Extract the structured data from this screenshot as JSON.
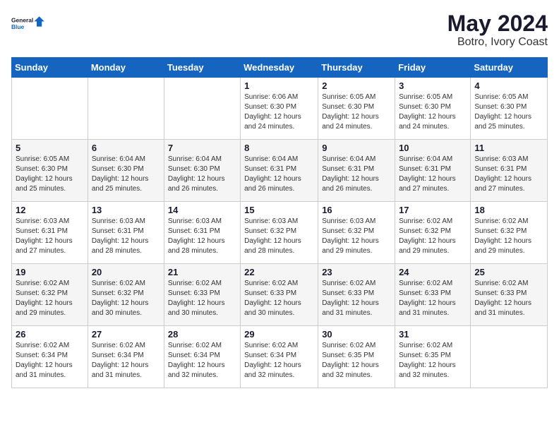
{
  "header": {
    "logo_line1": "General",
    "logo_line2": "Blue",
    "title": "May 2024",
    "subtitle": "Botro, Ivory Coast"
  },
  "days_of_week": [
    "Sunday",
    "Monday",
    "Tuesday",
    "Wednesday",
    "Thursday",
    "Friday",
    "Saturday"
  ],
  "weeks": [
    [
      {
        "day": "",
        "sunrise": "",
        "sunset": "",
        "daylight": ""
      },
      {
        "day": "",
        "sunrise": "",
        "sunset": "",
        "daylight": ""
      },
      {
        "day": "",
        "sunrise": "",
        "sunset": "",
        "daylight": ""
      },
      {
        "day": "1",
        "sunrise": "Sunrise: 6:06 AM",
        "sunset": "Sunset: 6:30 PM",
        "daylight": "Daylight: 12 hours and 24 minutes."
      },
      {
        "day": "2",
        "sunrise": "Sunrise: 6:05 AM",
        "sunset": "Sunset: 6:30 PM",
        "daylight": "Daylight: 12 hours and 24 minutes."
      },
      {
        "day": "3",
        "sunrise": "Sunrise: 6:05 AM",
        "sunset": "Sunset: 6:30 PM",
        "daylight": "Daylight: 12 hours and 24 minutes."
      },
      {
        "day": "4",
        "sunrise": "Sunrise: 6:05 AM",
        "sunset": "Sunset: 6:30 PM",
        "daylight": "Daylight: 12 hours and 25 minutes."
      }
    ],
    [
      {
        "day": "5",
        "sunrise": "Sunrise: 6:05 AM",
        "sunset": "Sunset: 6:30 PM",
        "daylight": "Daylight: 12 hours and 25 minutes."
      },
      {
        "day": "6",
        "sunrise": "Sunrise: 6:04 AM",
        "sunset": "Sunset: 6:30 PM",
        "daylight": "Daylight: 12 hours and 25 minutes."
      },
      {
        "day": "7",
        "sunrise": "Sunrise: 6:04 AM",
        "sunset": "Sunset: 6:30 PM",
        "daylight": "Daylight: 12 hours and 26 minutes."
      },
      {
        "day": "8",
        "sunrise": "Sunrise: 6:04 AM",
        "sunset": "Sunset: 6:31 PM",
        "daylight": "Daylight: 12 hours and 26 minutes."
      },
      {
        "day": "9",
        "sunrise": "Sunrise: 6:04 AM",
        "sunset": "Sunset: 6:31 PM",
        "daylight": "Daylight: 12 hours and 26 minutes."
      },
      {
        "day": "10",
        "sunrise": "Sunrise: 6:04 AM",
        "sunset": "Sunset: 6:31 PM",
        "daylight": "Daylight: 12 hours and 27 minutes."
      },
      {
        "day": "11",
        "sunrise": "Sunrise: 6:03 AM",
        "sunset": "Sunset: 6:31 PM",
        "daylight": "Daylight: 12 hours and 27 minutes."
      }
    ],
    [
      {
        "day": "12",
        "sunrise": "Sunrise: 6:03 AM",
        "sunset": "Sunset: 6:31 PM",
        "daylight": "Daylight: 12 hours and 27 minutes."
      },
      {
        "day": "13",
        "sunrise": "Sunrise: 6:03 AM",
        "sunset": "Sunset: 6:31 PM",
        "daylight": "Daylight: 12 hours and 28 minutes."
      },
      {
        "day": "14",
        "sunrise": "Sunrise: 6:03 AM",
        "sunset": "Sunset: 6:31 PM",
        "daylight": "Daylight: 12 hours and 28 minutes."
      },
      {
        "day": "15",
        "sunrise": "Sunrise: 6:03 AM",
        "sunset": "Sunset: 6:32 PM",
        "daylight": "Daylight: 12 hours and 28 minutes."
      },
      {
        "day": "16",
        "sunrise": "Sunrise: 6:03 AM",
        "sunset": "Sunset: 6:32 PM",
        "daylight": "Daylight: 12 hours and 29 minutes."
      },
      {
        "day": "17",
        "sunrise": "Sunrise: 6:02 AM",
        "sunset": "Sunset: 6:32 PM",
        "daylight": "Daylight: 12 hours and 29 minutes."
      },
      {
        "day": "18",
        "sunrise": "Sunrise: 6:02 AM",
        "sunset": "Sunset: 6:32 PM",
        "daylight": "Daylight: 12 hours and 29 minutes."
      }
    ],
    [
      {
        "day": "19",
        "sunrise": "Sunrise: 6:02 AM",
        "sunset": "Sunset: 6:32 PM",
        "daylight": "Daylight: 12 hours and 29 minutes."
      },
      {
        "day": "20",
        "sunrise": "Sunrise: 6:02 AM",
        "sunset": "Sunset: 6:32 PM",
        "daylight": "Daylight: 12 hours and 30 minutes."
      },
      {
        "day": "21",
        "sunrise": "Sunrise: 6:02 AM",
        "sunset": "Sunset: 6:33 PM",
        "daylight": "Daylight: 12 hours and 30 minutes."
      },
      {
        "day": "22",
        "sunrise": "Sunrise: 6:02 AM",
        "sunset": "Sunset: 6:33 PM",
        "daylight": "Daylight: 12 hours and 30 minutes."
      },
      {
        "day": "23",
        "sunrise": "Sunrise: 6:02 AM",
        "sunset": "Sunset: 6:33 PM",
        "daylight": "Daylight: 12 hours and 31 minutes."
      },
      {
        "day": "24",
        "sunrise": "Sunrise: 6:02 AM",
        "sunset": "Sunset: 6:33 PM",
        "daylight": "Daylight: 12 hours and 31 minutes."
      },
      {
        "day": "25",
        "sunrise": "Sunrise: 6:02 AM",
        "sunset": "Sunset: 6:33 PM",
        "daylight": "Daylight: 12 hours and 31 minutes."
      }
    ],
    [
      {
        "day": "26",
        "sunrise": "Sunrise: 6:02 AM",
        "sunset": "Sunset: 6:34 PM",
        "daylight": "Daylight: 12 hours and 31 minutes."
      },
      {
        "day": "27",
        "sunrise": "Sunrise: 6:02 AM",
        "sunset": "Sunset: 6:34 PM",
        "daylight": "Daylight: 12 hours and 31 minutes."
      },
      {
        "day": "28",
        "sunrise": "Sunrise: 6:02 AM",
        "sunset": "Sunset: 6:34 PM",
        "daylight": "Daylight: 12 hours and 32 minutes."
      },
      {
        "day": "29",
        "sunrise": "Sunrise: 6:02 AM",
        "sunset": "Sunset: 6:34 PM",
        "daylight": "Daylight: 12 hours and 32 minutes."
      },
      {
        "day": "30",
        "sunrise": "Sunrise: 6:02 AM",
        "sunset": "Sunset: 6:35 PM",
        "daylight": "Daylight: 12 hours and 32 minutes."
      },
      {
        "day": "31",
        "sunrise": "Sunrise: 6:02 AM",
        "sunset": "Sunset: 6:35 PM",
        "daylight": "Daylight: 12 hours and 32 minutes."
      },
      {
        "day": "",
        "sunrise": "",
        "sunset": "",
        "daylight": ""
      }
    ]
  ]
}
